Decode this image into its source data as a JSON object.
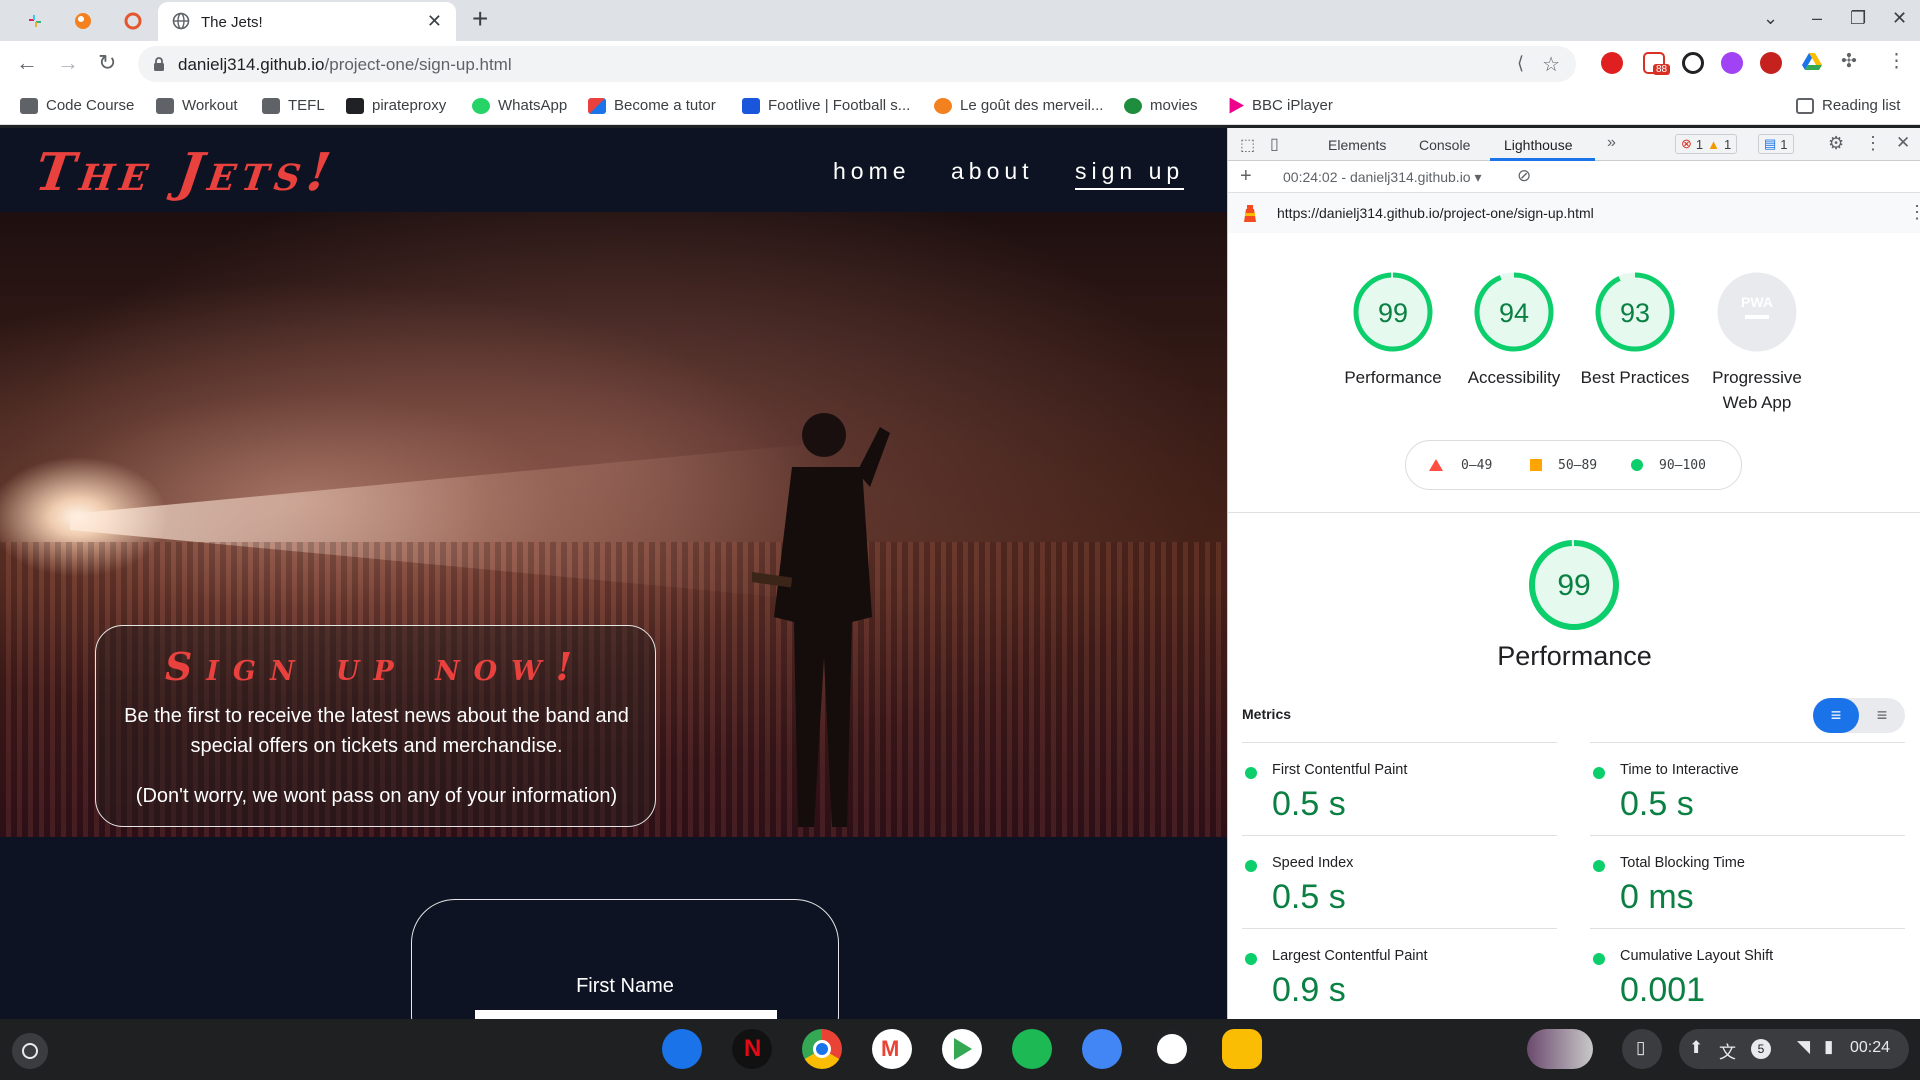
{
  "browser": {
    "active_tab_title": "The Jets!",
    "url_host": "danielj314.github.io",
    "url_path": "/project-one/sign-up.html",
    "extension_badge": "88",
    "bookmarks": [
      {
        "label": "Code Course",
        "icon": "folder-icon"
      },
      {
        "label": "Workout",
        "icon": "folder-icon"
      },
      {
        "label": "TEFL",
        "icon": "folder-icon"
      },
      {
        "label": "pirateproxy",
        "icon": "pirate-icon"
      },
      {
        "label": "WhatsApp",
        "icon": "whatsapp-icon"
      },
      {
        "label": "Become a tutor",
        "icon": "tutor-icon"
      },
      {
        "label": "Footlive | Football s...",
        "icon": "footlive-icon"
      },
      {
        "label": "Le goût des merveil...",
        "icon": "play-icon"
      },
      {
        "label": "movies",
        "icon": "movies-icon"
      },
      {
        "label": "BBC iPlayer",
        "icon": "iplayer-icon"
      }
    ],
    "reading_list": "Reading list"
  },
  "site": {
    "logo": "The Jets!",
    "nav": {
      "home": "home",
      "about": "about",
      "signup": "sign up"
    },
    "signup_title": "Sign up now!",
    "signup_text": "Be the first to receive the latest news about the band and special offers on tickets and merchandise.",
    "signup_note": "(Don't worry, we wont pass on any of your information)",
    "form_first_name": "First Name",
    "colors": {
      "accent": "#e8413e",
      "background": "#0d1322"
    }
  },
  "devtools": {
    "tabs": {
      "elements": "Elements",
      "console": "Console",
      "lighthouse": "Lighthouse"
    },
    "errors": "1",
    "warnings": "1",
    "messages": "1",
    "report_selector": "00:24:02 - danielj314.github.io",
    "report_url": "https://danielj314.github.io/project-one/sign-up.html",
    "scores": [
      {
        "value": "99",
        "score": 0.99,
        "label": "Performance"
      },
      {
        "value": "94",
        "score": 0.94,
        "label": "Accessibility"
      },
      {
        "value": "93",
        "score": 0.93,
        "label": "Best Practices"
      },
      {
        "value": "PWA",
        "score": 0,
        "label": "Progressive Web App"
      }
    ],
    "legend": {
      "low": "0–49",
      "mid": "50–89",
      "high": "90–100"
    },
    "section_score": "99",
    "section_title": "Performance",
    "metrics_title": "Metrics",
    "metrics": [
      {
        "name": "First Contentful Paint",
        "value": "0.5 s"
      },
      {
        "name": "Time to Interactive",
        "value": "0.5 s"
      },
      {
        "name": "Speed Index",
        "value": "0.5 s"
      },
      {
        "name": "Total Blocking Time",
        "value": "0 ms"
      },
      {
        "name": "Largest Contentful Paint",
        "value": "0.9 s"
      },
      {
        "name": "Cumulative Layout Shift",
        "value": "0.001"
      }
    ],
    "colors": {
      "pass": "#0cce6b",
      "average": "#ffa400",
      "fail": "#ff4e42"
    }
  },
  "shelf": {
    "notification_count": "5",
    "time": "00:24"
  }
}
